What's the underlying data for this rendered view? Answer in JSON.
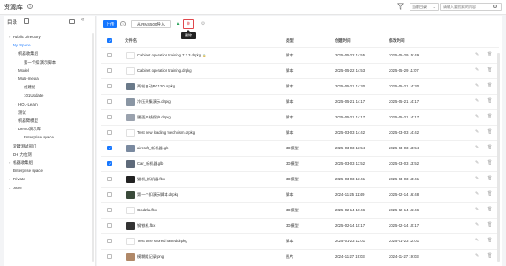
{
  "app": {
    "title": "资源库",
    "help": "?"
  },
  "header": {
    "scope_select": "当前目录",
    "search_placeholder": "请输入要搜索的内容"
  },
  "sidebar": {
    "title": "目录",
    "items": [
      {
        "label": "Public Directory",
        "arrow": "›"
      },
      {
        "label": "My Space",
        "arrow": "⌄"
      },
      {
        "label": "机器收集组",
        "arrow": "›"
      },
      {
        "label": "第一个扣演示脚本",
        "arrow": ""
      },
      {
        "label": "Model",
        "arrow": "›"
      },
      {
        "label": "Multi-media",
        "arrow": "›"
      },
      {
        "label": "创建组",
        "arrow": ""
      },
      {
        "label": "101Update",
        "arrow": ""
      },
      {
        "label": "HOL-Learn",
        "arrow": "›"
      },
      {
        "label": "测试",
        "arrow": ""
      },
      {
        "label": "机器臂模型",
        "arrow": "›"
      },
      {
        "label": "Demo演示库",
        "arrow": "›"
      },
      {
        "label": "Enterprise space",
        "arrow": ""
      },
      {
        "label": "双臂测试部门",
        "arrow": ""
      },
      {
        "label": "DH 力位测",
        "arrow": ""
      },
      {
        "label": "机器收集组",
        "arrow": "›"
      },
      {
        "label": "Enterprise space",
        "arrow": ""
      },
      {
        "label": "Private",
        "arrow": "›"
      },
      {
        "label": "AWS",
        "arrow": "›"
      }
    ]
  },
  "toolbar": {
    "upload": "上传",
    "help": "?",
    "import": "从RMS500导入",
    "move_icon": "▲",
    "delete_icon": "⊗",
    "more_icon": "⚙",
    "tooltip": "删除"
  },
  "table": {
    "columns": [
      "文件名",
      "类型",
      "创建时间",
      "修改时间"
    ],
    "rows": [
      {
        "name": "Cabinet operation training 7.3.3.drpkg",
        "locked": true,
        "type": "脚本",
        "created": "2025-05-22 14:55",
        "modified": "2025-05-29 15:49",
        "checked": false,
        "thumb_color": "#ffffff"
      },
      {
        "name": "Cabinet operation training.drpkg",
        "locked": false,
        "type": "脚本",
        "created": "2025-05-22 14:53",
        "modified": "2025-05-29 11:07",
        "checked": false,
        "thumb_color": "#ffffff"
      },
      {
        "name": "两轮自动BC120.drpkg",
        "locked": false,
        "type": "脚本",
        "created": "2025-05-21 14:30",
        "modified": "2025-05-21 14:30",
        "checked": false,
        "thumb_color": "#6a7a8a"
      },
      {
        "name": "冷压采集演示.drpkg",
        "locked": false,
        "type": "脚本",
        "created": "2025-05-21 14:17",
        "modified": "2025-05-21 14:17",
        "checked": false,
        "thumb_color": "#8a96a4"
      },
      {
        "name": "履面产线保护.drpkg",
        "locked": false,
        "type": "脚本",
        "created": "2025-05-21 14:17",
        "modified": "2025-05-21 14:17",
        "checked": false,
        "thumb_color": "#9aa2ae"
      },
      {
        "name": "Test new loading mechnism.drpkg",
        "locked": false,
        "type": "脚本",
        "created": "2025-03-03 14:42",
        "modified": "2025-03-03 14:42",
        "checked": false,
        "thumb_color": "#ffffff"
      },
      {
        "name": "aircraft_新机器.glb",
        "locked": false,
        "type": "3D模型",
        "created": "2025-03-03 13:54",
        "modified": "2025-03-03 13:54",
        "checked": true,
        "thumb_color": "#7a8aa0"
      },
      {
        "name": "Car_新机器.glb",
        "locked": false,
        "type": "3D模型",
        "created": "2025-03-03 13:52",
        "modified": "2025-03-03 13:52",
        "checked": true,
        "thumb_color": "#5e6a7a"
      },
      {
        "name": "猫机_新机器.fbx",
        "locked": false,
        "type": "3D模型",
        "created": "2025-03-03 13:41",
        "modified": "2025-03-03 13:41",
        "checked": false,
        "thumb_color": "#222222"
      },
      {
        "name": "第一个扣演示脚本.drpkg",
        "locked": false,
        "type": "脚本",
        "created": "2024-11-25 11:49",
        "modified": "2025-02-14 16:48",
        "checked": false,
        "thumb_color": "#3a4a3a"
      },
      {
        "name": "Godzila.fbx",
        "locked": false,
        "type": "3D模型",
        "created": "2025-02-14 16:46",
        "modified": "2025-02-14 16:46",
        "checked": false,
        "thumb_color": "#ffffff"
      },
      {
        "name": "钢铁机.fbx",
        "locked": false,
        "type": "3D模型",
        "created": "2025-02-14 10:17",
        "modified": "2025-02-14 10:17",
        "checked": false,
        "thumb_color": "#333333"
      },
      {
        "name": "Test time scored based.drpkg",
        "locked": false,
        "type": "脚本",
        "created": "2025-01-23 12:01",
        "modified": "2025-01-23 12:01",
        "checked": false,
        "thumb_color": "#ffffff"
      },
      {
        "name": "模糊组记录.png",
        "locked": false,
        "type": "图片",
        "created": "2024-11-27 19:03",
        "modified": "2024-11-27 19:03",
        "checked": false,
        "thumb_color": "#b08868"
      }
    ]
  },
  "icons": {
    "edit": "✎",
    "delete": "🗑"
  },
  "colors": {
    "accent": "#1677ff",
    "danger": "#e0474c",
    "success": "#29a35a"
  }
}
